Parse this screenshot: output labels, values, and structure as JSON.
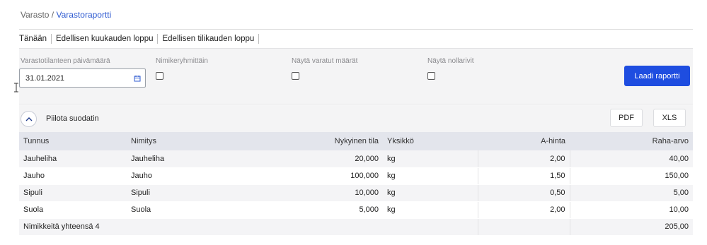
{
  "breadcrumb": {
    "root": "Varasto",
    "separator": " / ",
    "current": "Varastoraportti"
  },
  "quick_links": [
    "Tänään",
    "Edellisen kuukauden loppu",
    "Edellisen tilikauden loppu"
  ],
  "filters": {
    "date_label": "Varastotilanteen päivämäärä",
    "date_value": "31.01.2021",
    "group_label": "Nimikeryhmittäin",
    "reserved_label": "Näytä varatut määrät",
    "zero_label": "Näytä nollarivit",
    "load_button": "Laadi raportti"
  },
  "toolbar": {
    "hide_filter_label": "Piilota suodatin",
    "pdf_label": "PDF",
    "xls_label": "XLS"
  },
  "table": {
    "headers": [
      "Tunnus",
      "Nimitys",
      "Nykyinen tila",
      "Yksikkö",
      "A-hinta",
      "Raha-arvo"
    ],
    "rows": [
      [
        "Jauheliha",
        "Jauheliha",
        "20,000",
        "kg",
        "2,00",
        "40,00"
      ],
      [
        "Jauho",
        "Jauho",
        "100,000",
        "kg",
        "1,50",
        "150,00"
      ],
      [
        "Sipuli",
        "Sipuli",
        "10,000",
        "kg",
        "0,50",
        "5,00"
      ],
      [
        "Suola",
        "Suola",
        "5,000",
        "kg",
        "2,00",
        "10,00"
      ]
    ],
    "footer_label": "Nimikkeitä yhteensä 4",
    "footer_total": "205,00"
  },
  "colors": {
    "accent": "#1e4de0",
    "link": "#2f5bd1",
    "header_bg": "#e3e5ec"
  }
}
